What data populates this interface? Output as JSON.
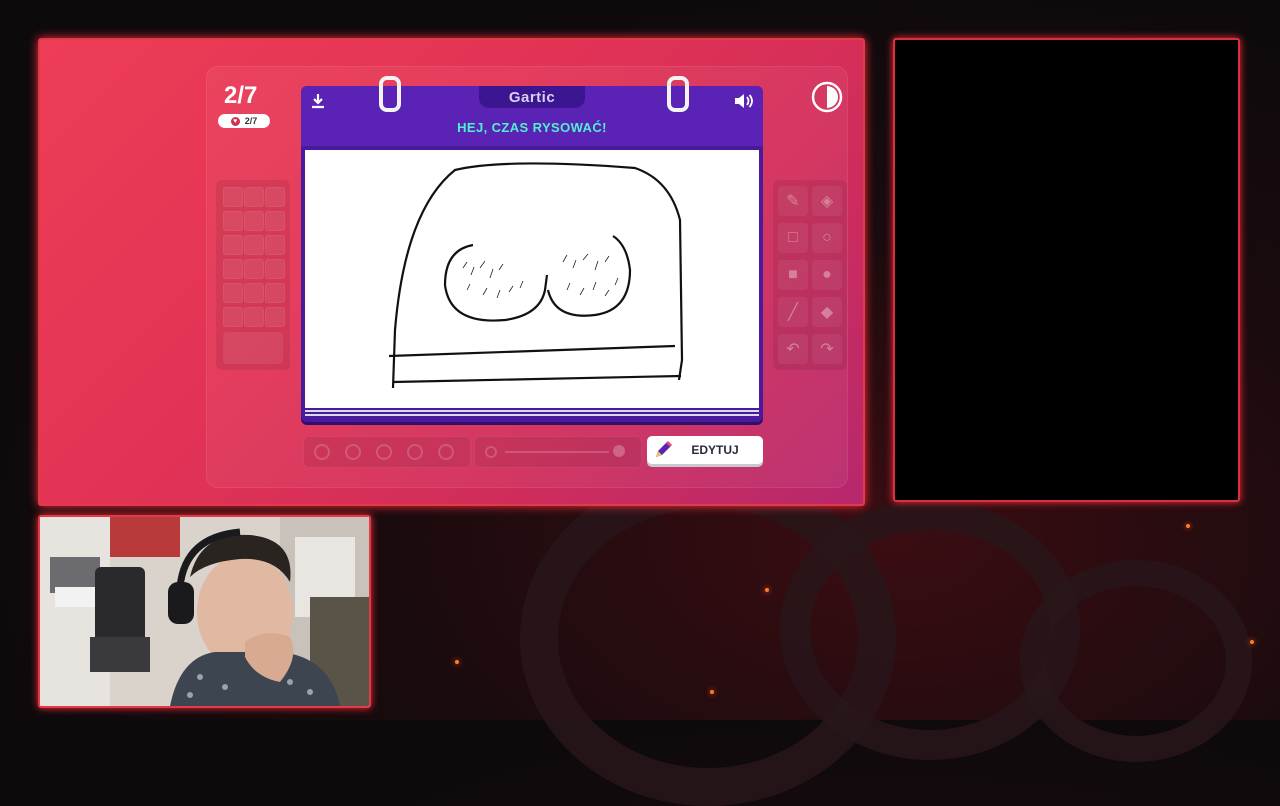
{
  "game": {
    "round_counter": "2/7",
    "round_badge": "2/7",
    "logo": "Gartic",
    "prompt": "HEJ, CZAS RYSOWAĆ!",
    "edit_button": "EDYTUJ",
    "icons": {
      "download": "download-icon",
      "sound": "speaker-icon",
      "contrast": "contrast-icon",
      "edit": "pencil-icon"
    },
    "tools": [
      "pencil-icon",
      "eraser-icon",
      "square-outline-icon",
      "circle-outline-icon",
      "square-filled-icon",
      "circle-filled-icon",
      "line-icon",
      "fill-bucket-icon",
      "undo-icon",
      "redo-icon"
    ]
  },
  "colors": {
    "frame_border": "#e23a47",
    "card_purple": "#4a1a9c",
    "prompt_text": "#4ff0d0",
    "game_bg": "#e33355"
  }
}
